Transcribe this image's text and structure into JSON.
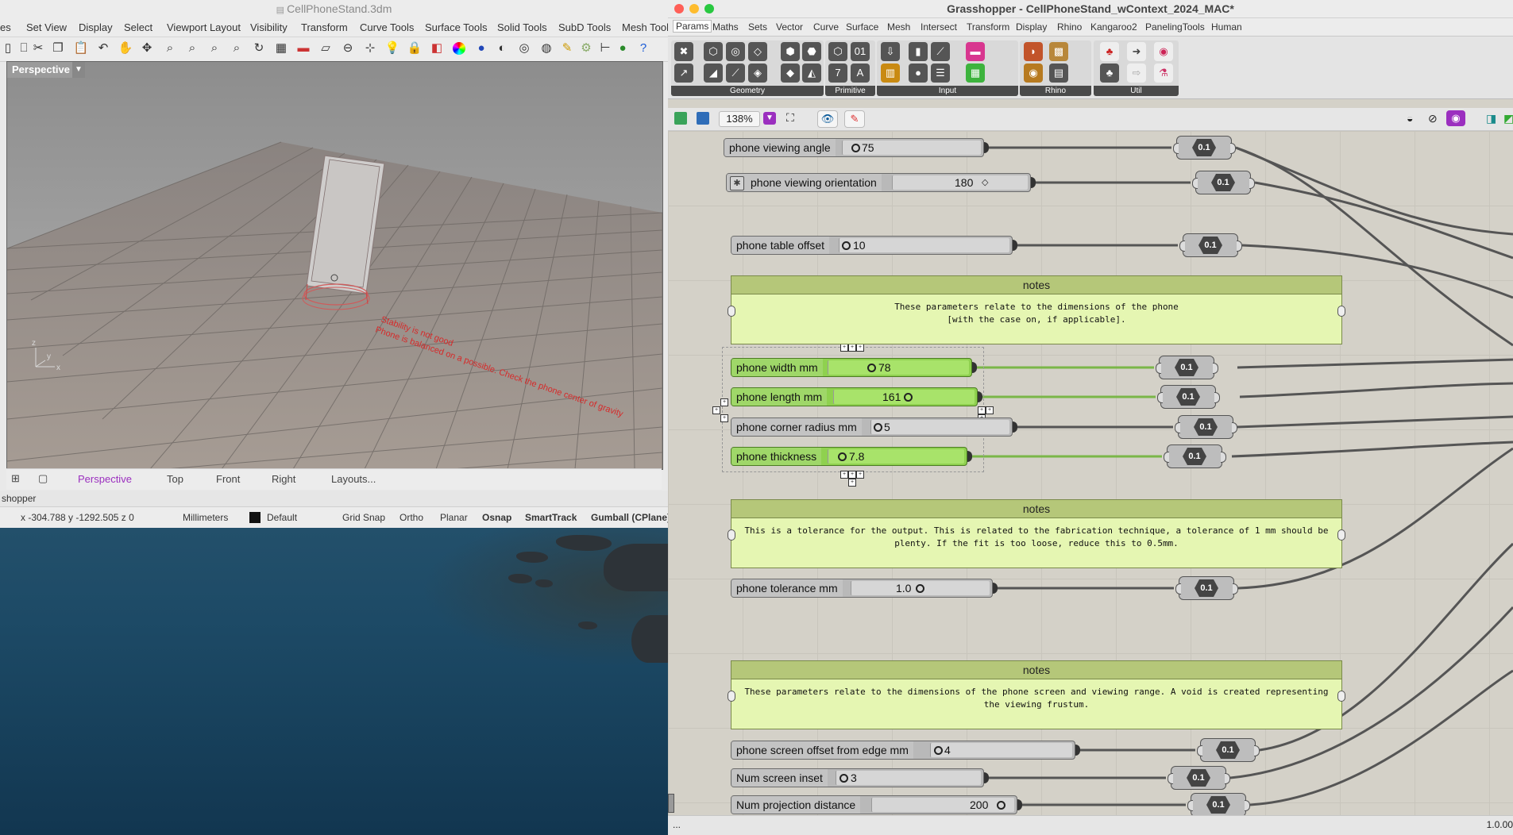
{
  "rhino": {
    "title": "CellPhoneStand.3dm",
    "menu": [
      "es",
      "Set View",
      "Display",
      "Select",
      "Viewport Layout",
      "Visibility",
      "Transform",
      "Curve Tools",
      "Surface Tools",
      "Solid Tools",
      "SubD Tools",
      "Mesh Tools"
    ],
    "viewport": {
      "label": "Perspective",
      "annotation_line1": "Stability is not good",
      "annotation_line2": "Phone is balanced on a possible. Check the phone center of gravity"
    },
    "view_tabs": [
      "Perspective",
      "Top",
      "Front",
      "Right",
      "Layouts..."
    ],
    "command_line": "shopper",
    "status": {
      "coords": "x -304.788  y -1292.505  z 0",
      "units": "Millimeters",
      "layer": "Default",
      "toggles": [
        "Grid Snap",
        "Ortho",
        "Planar",
        "Osnap",
        "SmartTrack",
        "Gumball (CPlane)"
      ],
      "active_toggles": [
        "Osnap",
        "SmartTrack",
        "Gumball (CPlane)"
      ]
    }
  },
  "gh": {
    "title": "Grasshopper - CellPhoneStand_wContext_2024_MAC*",
    "tabs": [
      "Params",
      "Maths",
      "Sets",
      "Vector",
      "Curve",
      "Surface",
      "Mesh",
      "Intersect",
      "Transform",
      "Display",
      "Rhino",
      "Kangaroo2",
      "PanelingTools",
      "Human"
    ],
    "active_tab": "Params",
    "ribbon_groups": [
      "Geometry",
      "Primitive",
      "Input",
      "Rhino",
      "Util"
    ],
    "zoom": "138%",
    "number_param_label": "0.1",
    "status_right": "1.0.00",
    "status_left": "...",
    "sliders": [
      {
        "label": "phone viewing angle",
        "value": "75",
        "fraction": 0.2
      },
      {
        "label": "phone viewing orientation",
        "value": "180",
        "fraction": 0.55
      },
      {
        "label": "phone table offset",
        "value": "10",
        "fraction": 0.05
      },
      {
        "label": "phone width mm",
        "value": "78",
        "fraction": 0.3
      },
      {
        "label": "phone length mm",
        "value": "161",
        "fraction": 0.55
      },
      {
        "label": "phone corner radius mm",
        "value": "5",
        "fraction": 0.05
      },
      {
        "label": "phone thickness",
        "value": "7.8",
        "fraction": 0.05
      },
      {
        "label": "phone tolerance mm",
        "value": "1.0",
        "fraction": 0.45
      },
      {
        "label": "phone  screen offset from edge mm",
        "value": "4",
        "fraction": 0.05
      },
      {
        "label": "Num screen inset",
        "value": "3",
        "fraction": 0.05
      },
      {
        "label": "Num projection distance",
        "value": "200",
        "fraction": 0.95
      }
    ],
    "notes": [
      {
        "title": "notes",
        "body": "These parameters relate to the dimensions of the phone\n[with the case on, if applicable]."
      },
      {
        "title": "notes",
        "body": "This is a tolerance for the output.  This is related to the fabrication technique, a tolerance of 1 mm should be\nplenty.  If the fit is too loose, reduce this to 0.5mm."
      },
      {
        "title": "notes",
        "body": "These parameters relate to the dimensions of the phone screen and viewing range. A void is created representing\nthe viewing frustum."
      }
    ]
  },
  "colors": {
    "selected_slider": "#8fd14f",
    "slider": "#b9b9b9",
    "notes_bg": "#e5f6b2",
    "notes_header": "#b5c779",
    "wire": "#555555",
    "wire_selected": "#7ab648",
    "annotation": "#d62a2a"
  }
}
